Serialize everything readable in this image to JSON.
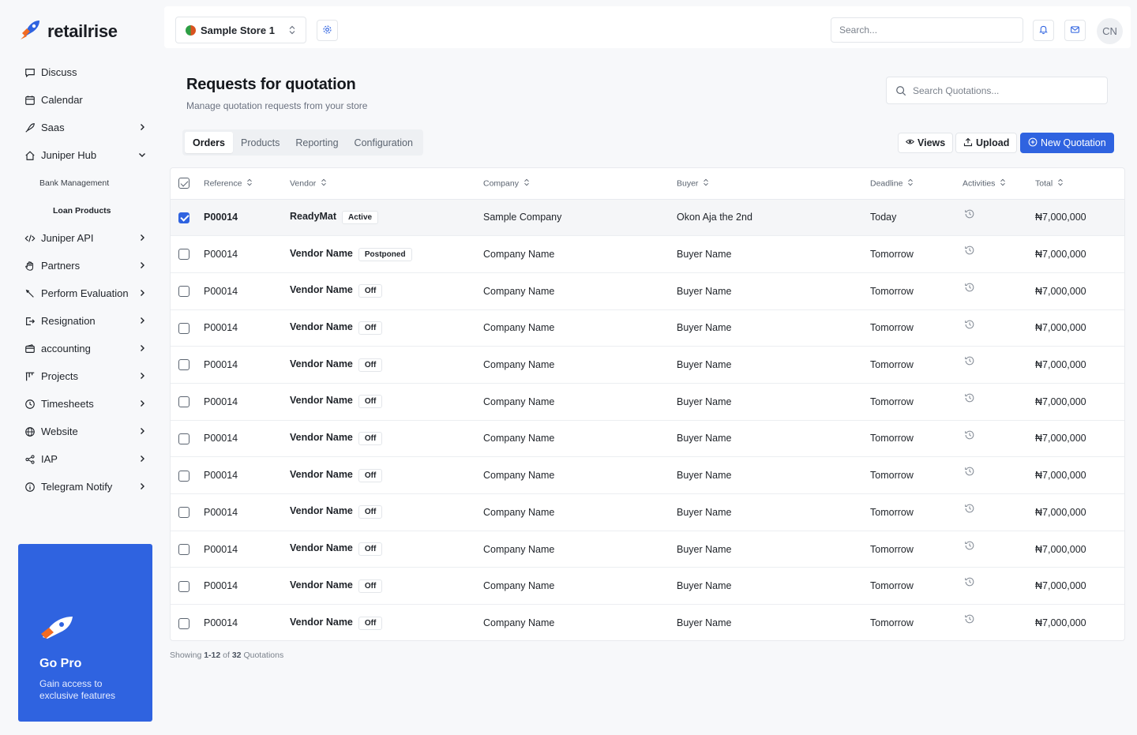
{
  "brand": {
    "name": "retailrise"
  },
  "topbar": {
    "store": "Sample Store 1",
    "search_placeholder": "Search...",
    "avatar_initials": "CN"
  },
  "sidebar": {
    "items": [
      {
        "label": "Discuss",
        "icon": "chat-icon",
        "chevron": ""
      },
      {
        "label": "Calendar",
        "icon": "calendar-icon",
        "chevron": ""
      },
      {
        "label": "Saas",
        "icon": "rocket-icon",
        "chevron": "right"
      },
      {
        "label": "Juniper Hub",
        "icon": "home-icon",
        "chevron": "down"
      },
      {
        "label": "Juniper API",
        "icon": "code-icon",
        "chevron": "right"
      },
      {
        "label": "Partners",
        "icon": "hand-icon",
        "chevron": "right"
      },
      {
        "label": "Perform Evaluation",
        "icon": "pen-icon",
        "chevron": "right"
      },
      {
        "label": "Resignation",
        "icon": "exit-icon",
        "chevron": "right"
      },
      {
        "label": "accounting",
        "icon": "wallet-icon",
        "chevron": "right"
      },
      {
        "label": "Projects",
        "icon": "projects-icon",
        "chevron": "right"
      },
      {
        "label": "Timesheets",
        "icon": "clock-icon",
        "chevron": "right"
      },
      {
        "label": "Website",
        "icon": "globe-icon",
        "chevron": "right"
      },
      {
        "label": "IAP",
        "icon": "share-icon",
        "chevron": "right"
      },
      {
        "label": "Telegram Notify",
        "icon": "info-icon",
        "chevron": "right"
      }
    ],
    "sub_items": [
      "Bank Management",
      "Loan Products"
    ]
  },
  "promo": {
    "title": "Go Pro",
    "subtitle": "Gain access to exclusive features"
  },
  "page": {
    "title": "Requests for quotation",
    "subtitle": "Manage quotation requests from your store",
    "search_placeholder": "Search Quotations..."
  },
  "tabs": [
    "Orders",
    "Products",
    "Reporting",
    "Configuration"
  ],
  "actions": {
    "views": "Views",
    "upload": "Upload",
    "new": "New Quotation"
  },
  "table": {
    "columns": [
      "Reference",
      "Vendor",
      "Company",
      "Buyer",
      "Deadline",
      "Activities",
      "Total"
    ],
    "rows": [
      {
        "reference": "P00014",
        "vendor": "ReadyMat",
        "status": "Active",
        "company": "Sample Company",
        "buyer": "Okon Aja the 2nd",
        "deadline": "Today",
        "total": "₦7,000,000",
        "selected": true
      },
      {
        "reference": "P00014",
        "vendor": "Vendor Name",
        "status": "Postponed",
        "company": "Company Name",
        "buyer": "Buyer Name",
        "deadline": "Tomorrow",
        "total": "₦7,000,000",
        "selected": false
      },
      {
        "reference": "P00014",
        "vendor": "Vendor Name",
        "status": "Off",
        "company": "Company Name",
        "buyer": "Buyer Name",
        "deadline": "Tomorrow",
        "total": "₦7,000,000",
        "selected": false
      },
      {
        "reference": "P00014",
        "vendor": "Vendor Name",
        "status": "Off",
        "company": "Company Name",
        "buyer": "Buyer Name",
        "deadline": "Tomorrow",
        "total": "₦7,000,000",
        "selected": false
      },
      {
        "reference": "P00014",
        "vendor": "Vendor Name",
        "status": "Off",
        "company": "Company Name",
        "buyer": "Buyer Name",
        "deadline": "Tomorrow",
        "total": "₦7,000,000",
        "selected": false
      },
      {
        "reference": "P00014",
        "vendor": "Vendor Name",
        "status": "Off",
        "company": "Company Name",
        "buyer": "Buyer Name",
        "deadline": "Tomorrow",
        "total": "₦7,000,000",
        "selected": false
      },
      {
        "reference": "P00014",
        "vendor": "Vendor Name",
        "status": "Off",
        "company": "Company Name",
        "buyer": "Buyer Name",
        "deadline": "Tomorrow",
        "total": "₦7,000,000",
        "selected": false
      },
      {
        "reference": "P00014",
        "vendor": "Vendor Name",
        "status": "Off",
        "company": "Company Name",
        "buyer": "Buyer Name",
        "deadline": "Tomorrow",
        "total": "₦7,000,000",
        "selected": false
      },
      {
        "reference": "P00014",
        "vendor": "Vendor Name",
        "status": "Off",
        "company": "Company Name",
        "buyer": "Buyer Name",
        "deadline": "Tomorrow",
        "total": "₦7,000,000",
        "selected": false
      },
      {
        "reference": "P00014",
        "vendor": "Vendor Name",
        "status": "Off",
        "company": "Company Name",
        "buyer": "Buyer Name",
        "deadline": "Tomorrow",
        "total": "₦7,000,000",
        "selected": false
      },
      {
        "reference": "P00014",
        "vendor": "Vendor Name",
        "status": "Off",
        "company": "Company Name",
        "buyer": "Buyer Name",
        "deadline": "Tomorrow",
        "total": "₦7,000,000",
        "selected": false
      },
      {
        "reference": "P00014",
        "vendor": "Vendor Name",
        "status": "Off",
        "company": "Company Name",
        "buyer": "Buyer Name",
        "deadline": "Tomorrow",
        "total": "₦7,000,000",
        "selected": false
      }
    ]
  },
  "footer": {
    "prefix": "Showing",
    "range": "1-12",
    "of": "of",
    "count": "32",
    "suffix": "Quotations"
  },
  "colors": {
    "primary": "#2f63e0",
    "promo_bg": "#2f63e0",
    "logo_orange": "#f26b21"
  }
}
